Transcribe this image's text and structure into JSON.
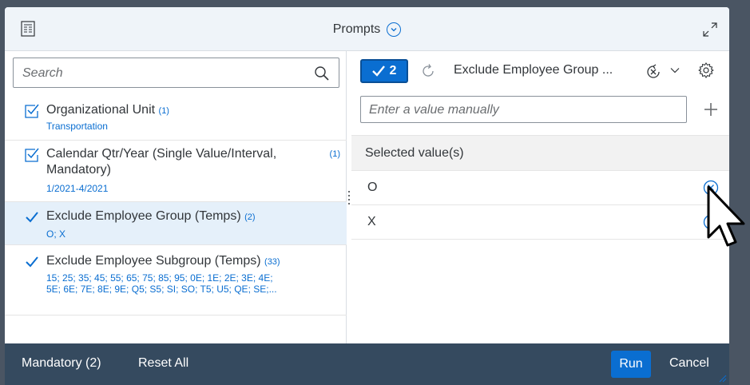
{
  "dialog": {
    "title": "Prompts"
  },
  "search": {
    "placeholder": "Search"
  },
  "prompts": [
    {
      "name": "Organizational Unit",
      "count": "(1)",
      "value": "Transportation"
    },
    {
      "name": "Calendar Qtr/Year (Single Value/Interval,",
      "name_line2": "Mandatory)",
      "count": "(1)",
      "value": "1/2021-4/2021"
    },
    {
      "name": "Exclude Employee Group (Temps)",
      "count": "(2)",
      "value": "O; X"
    },
    {
      "name": "Exclude Employee Subgroup (Temps)",
      "count": "(33)",
      "value_line1": "15; 25; 35; 45; 55; 65; 75; 85; 95; 0E; 1E; 2E; 3E; 4E;",
      "value_line2": "5E; 6E; 7E; 8E; 9E; Q5; S5; SI; SO; T5; U5; QE; SE;..."
    }
  ],
  "right_panel": {
    "selected_count": "2",
    "title": "Exclude Employee Group ...",
    "manual_placeholder": "Enter a value manually",
    "selected_header": "Selected value(s)",
    "selected_values": [
      "O",
      "X"
    ]
  },
  "footer": {
    "mandatory": "Mandatory (2)",
    "reset_all": "Reset All",
    "run": "Run",
    "cancel": "Cancel"
  },
  "colors": {
    "accent": "#0a6ed1",
    "footer_bg": "#354a5f",
    "header_bg": "#eff4f9",
    "selected_row_bg": "#e5f0fa"
  }
}
